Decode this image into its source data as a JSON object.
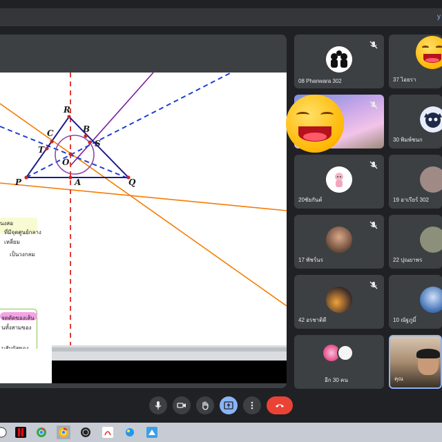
{
  "browser": {
    "extension_text": "y"
  },
  "slide": {
    "geometry_labels": [
      "R",
      "C",
      "B",
      "T",
      "S",
      "O",
      "P",
      "A",
      "Q"
    ],
    "thai_lines": [
      "นงสอ",
      "ที่มีจุดศูนย์กลาง",
      "เหลี่ยม",
      "เป็นวงกลม",
      "จดตัดของเส้น",
      "นทั้งสามของ",
      "นสัมผัสของ"
    ]
  },
  "participants": [
    {
      "name": "08 Phanwara 302"
    },
    {
      "name": "37 ไอยรา"
    },
    {
      "name": ""
    },
    {
      "name": "30 พิมพ์ชนก"
    },
    {
      "name": "20ชัยกันต์"
    },
    {
      "name": "19 อาเรียร์ 302"
    },
    {
      "name": "17 พัชร์นร"
    },
    {
      "name": "22 ปุณยาพร"
    },
    {
      "name": "42 อรชาติดี"
    },
    {
      "name": "10 ณัฐภูมิ์"
    },
    {
      "name": "อีก 30 คน"
    },
    {
      "name": "คุณ"
    }
  ],
  "colors": {
    "accent": "#8ab4f8",
    "leave": "#ea4335",
    "triangle": "#1a1a8c",
    "median": "#e53935",
    "bisector": "#1e3fd6",
    "orange": "#f57c00",
    "purple": "#7b1fa2"
  },
  "icons": [
    "mic-off-icon",
    "mic-icon",
    "camera-icon",
    "hand-icon",
    "present-icon",
    "more-icon",
    "phone-end-icon"
  ]
}
